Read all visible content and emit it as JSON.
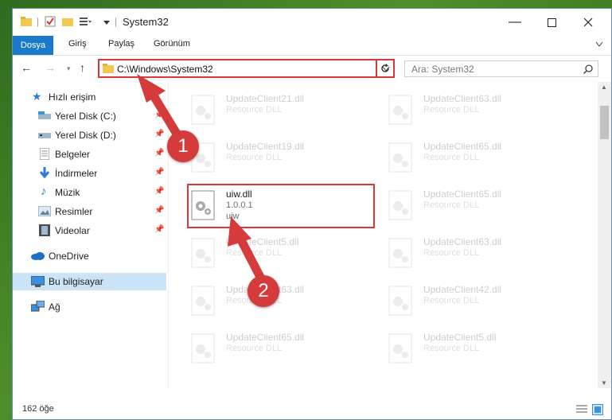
{
  "window": {
    "title": "System32"
  },
  "ribbon": {
    "tabs": [
      "Dosya",
      "Giriş",
      "Paylaş",
      "Görünüm"
    ]
  },
  "address": {
    "path": "C:\\Windows\\System32"
  },
  "search": {
    "placeholder": "Ara: System32"
  },
  "sidebar": {
    "items": [
      {
        "label": "Hızlı erişim",
        "icon": "star-icon",
        "pinned": false
      },
      {
        "label": "Yerel Disk (C:)",
        "icon": "drive-icon",
        "pinned": true
      },
      {
        "label": "Yerel Disk (D:)",
        "icon": "drive-icon",
        "pinned": true
      },
      {
        "label": "Belgeler",
        "icon": "documents-icon",
        "pinned": true
      },
      {
        "label": "İndirmeler",
        "icon": "download-icon",
        "pinned": true
      },
      {
        "label": "Müzik",
        "icon": "music-icon",
        "pinned": true
      },
      {
        "label": "Resimler",
        "icon": "pictures-icon",
        "pinned": true
      },
      {
        "label": "Videolar",
        "icon": "videos-icon",
        "pinned": true
      },
      {
        "label": "OneDrive",
        "icon": "cloud-icon",
        "pinned": false
      },
      {
        "label": "Bu bilgisayar",
        "icon": "computer-icon",
        "pinned": false
      },
      {
        "label": "Ağ",
        "icon": "network-icon",
        "pinned": false
      }
    ]
  },
  "files": {
    "left": [
      {
        "name": "UpdateClient21.dll",
        "desc": "Resource DLL"
      },
      {
        "name": "UpdateClient19.dll",
        "desc": "Resource DLL"
      },
      {
        "name": "uiw.dll",
        "version": "1.0.0.1",
        "desc": "uiw"
      },
      {
        "name": "UpdateClient5.dll",
        "desc": "Resource DLL"
      },
      {
        "name": "UpdateClient63.dll",
        "desc": "Resource DLL"
      },
      {
        "name": "UpdateClient65.dll",
        "desc": "Resource DLL"
      }
    ],
    "right": [
      {
        "name": "UpdateClient63.dll",
        "desc": "Resource DLL"
      },
      {
        "name": "UpdateClient65.dll",
        "desc": "Resource DLL"
      },
      {
        "name": "UpdateClient65.dll",
        "desc": "Resource DLL"
      },
      {
        "name": "UpdateClient63.dll",
        "desc": "Resource DLL"
      },
      {
        "name": "UpdateClient42.dll",
        "desc": "Resource DLL"
      },
      {
        "name": "UpdateClient5.dll",
        "desc": "Resource DLL"
      }
    ]
  },
  "annotations": {
    "step1": "1",
    "step2": "2",
    "color": "#d63b3b"
  },
  "status": {
    "count": "162 öğe"
  }
}
